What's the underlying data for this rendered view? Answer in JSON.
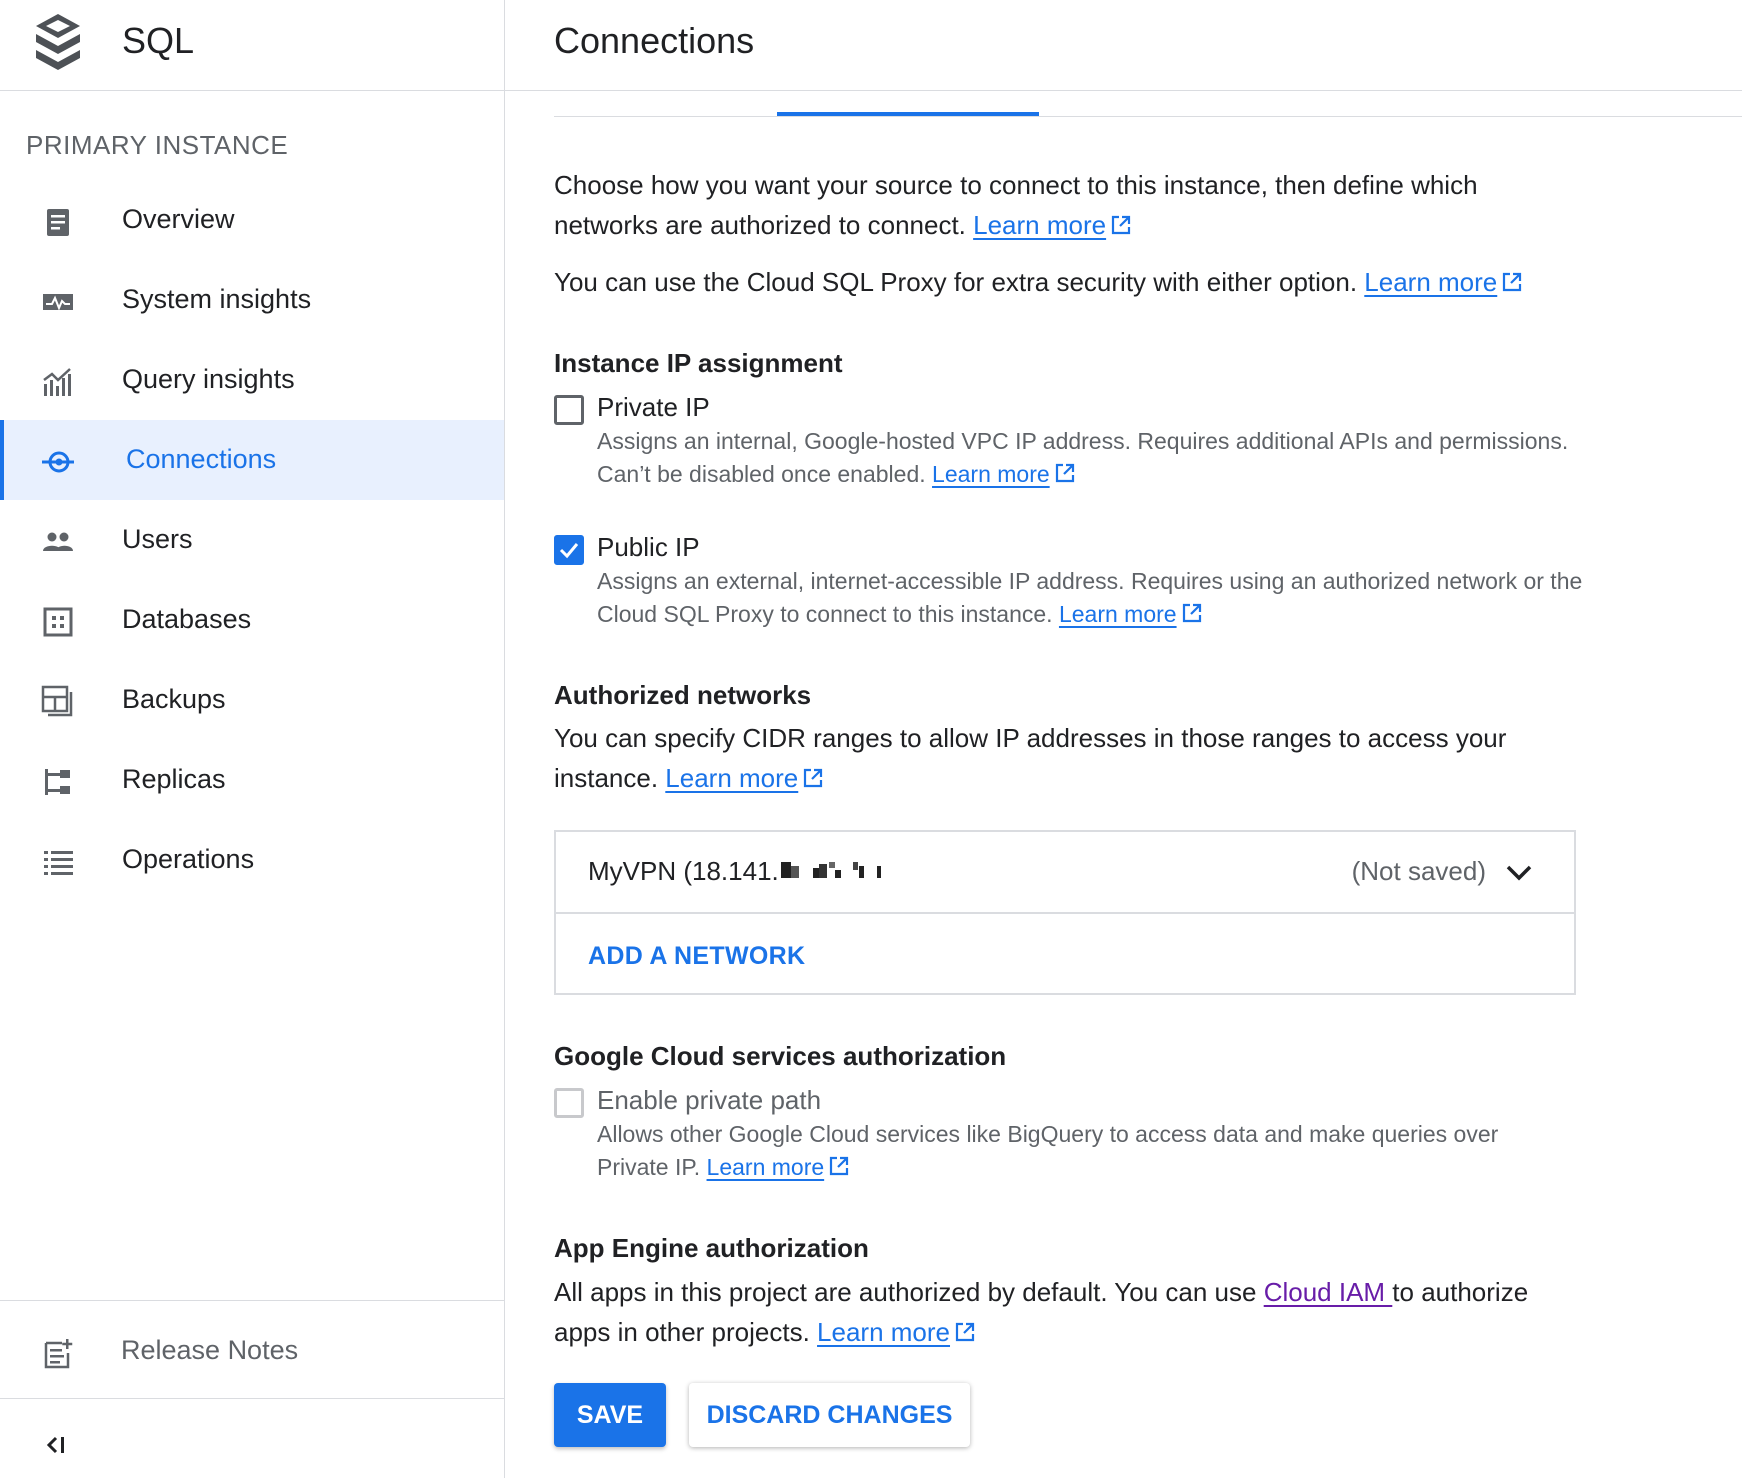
{
  "app": {
    "title": "SQL",
    "logo_icon": "sql-stack-logo"
  },
  "sidebar": {
    "section_label": "PRIMARY INSTANCE",
    "items": [
      {
        "label": "Overview",
        "icon": "overview-icon"
      },
      {
        "label": "System insights",
        "icon": "monitor-icon"
      },
      {
        "label": "Query insights",
        "icon": "analytics-icon"
      },
      {
        "label": "Connections",
        "icon": "connection-icon",
        "active": true
      },
      {
        "label": "Users",
        "icon": "people-icon"
      },
      {
        "label": "Databases",
        "icon": "database-grid-icon"
      },
      {
        "label": "Backups",
        "icon": "backup-icon"
      },
      {
        "label": "Replicas",
        "icon": "replica-tree-icon"
      },
      {
        "label": "Operations",
        "icon": "list-icon"
      }
    ],
    "release_notes": "Release Notes",
    "collapse_icon": "collapse-sidebar-icon"
  },
  "page": {
    "title": "Connections"
  },
  "intro": {
    "line1_text": "Choose how you want your source to connect to this instance, then define which networks are authorized to connect. ",
    "line1_link": "Learn more",
    "line2_text": "You can use the Cloud SQL Proxy for extra security with either option. ",
    "line2_link": "Learn more"
  },
  "ip_assignment": {
    "heading": "Instance IP assignment",
    "private_ip": {
      "label": "Private IP",
      "checked": false,
      "description": "Assigns an internal, Google-hosted VPC IP address. Requires additional APIs and permissions. Can’t be disabled once enabled. ",
      "link": "Learn more"
    },
    "public_ip": {
      "label": "Public IP",
      "checked": true,
      "description": "Assigns an external, internet-accessible IP address. Requires using an authorized network or the Cloud SQL Proxy to connect to this instance. ",
      "link": "Learn more"
    }
  },
  "authorized_networks": {
    "heading": "Authorized networks",
    "description": "You can specify CIDR ranges to allow IP addresses in those ranges to access your instance. ",
    "link": "Learn more",
    "networks": [
      {
        "name": "MyVPN (18.141.",
        "status": "(Not saved)"
      }
    ],
    "add_label": "ADD A NETWORK"
  },
  "gcs_auth": {
    "heading": "Google Cloud services authorization",
    "label": "Enable private path",
    "checked": false,
    "disabled": true,
    "description": "Allows other Google Cloud services like BigQuery to access data and make queries over Private IP. ",
    "link": "Learn more"
  },
  "app_engine": {
    "heading": "App Engine authorization",
    "text_before": "All apps in this project are authorized by default. You can use ",
    "iam_link": "Cloud IAM ",
    "text_after": "to authorize apps in other projects. ",
    "link": "Learn more"
  },
  "actions": {
    "save": "SAVE",
    "discard": "DISCARD CHANGES"
  },
  "colors": {
    "accent": "#1a73e8",
    "active_bg": "#e8f0fe",
    "visited_link": "#681da8"
  }
}
